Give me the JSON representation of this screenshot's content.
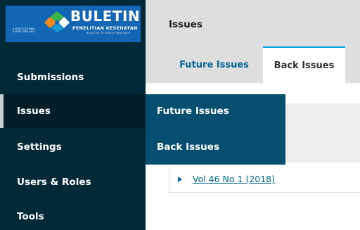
{
  "logo": {
    "title": "BULETIN",
    "subtitle": "PENELITIAN KESEHATAN",
    "tagline": "BULLETIN OF HEALTH RESEARCH",
    "issn": "p-ISSN 0125-9695\ne-ISSN 2338-3453",
    "colors": {
      "background": "#1366b3",
      "mark_green": "#3cb44b",
      "mark_orange": "#f28c1e",
      "mark_blue": "#1c9ad6"
    }
  },
  "sidebar": {
    "items": [
      {
        "label": "Submissions"
      },
      {
        "label": "Issues"
      },
      {
        "label": "Settings"
      },
      {
        "label": "Users & Roles"
      },
      {
        "label": "Tools"
      }
    ]
  },
  "header": {
    "title": "Issues"
  },
  "tabs": [
    {
      "label": "Future Issues"
    },
    {
      "label": "Back Issues"
    }
  ],
  "flyout": {
    "items": [
      {
        "label": "Future Issues"
      },
      {
        "label": "Back Issues"
      }
    ]
  },
  "issues": [
    {
      "label": "Vol 46 No 1 (2018)"
    }
  ],
  "colors": {
    "sidebar": "#022938",
    "flyout": "#054e70",
    "link": "#006798",
    "tab_accent": "#00a2e0"
  }
}
